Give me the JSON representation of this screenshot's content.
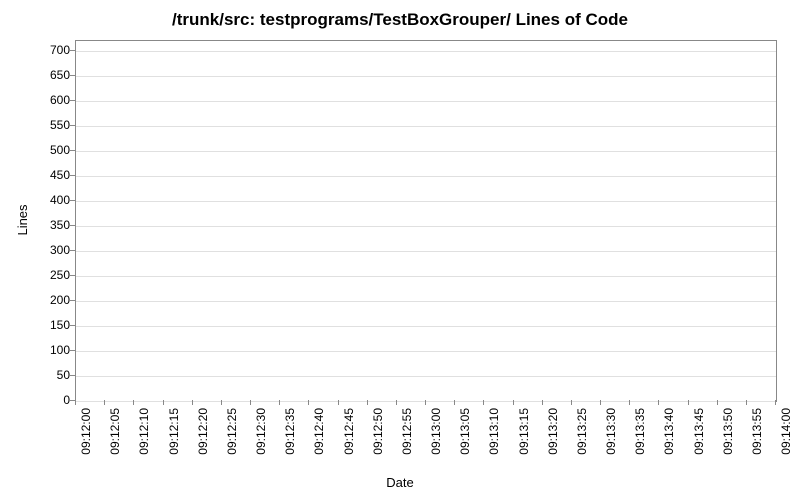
{
  "chart_data": {
    "type": "line",
    "title": "/trunk/src: testprograms/TestBoxGrouper/ Lines of Code",
    "xlabel": "Date",
    "ylabel": "Lines",
    "ylim": [
      0,
      720
    ],
    "y_ticks": [
      0,
      50,
      100,
      150,
      200,
      250,
      300,
      350,
      400,
      450,
      500,
      550,
      600,
      650,
      700
    ],
    "x_ticks": [
      "09:12:00",
      "09:12:05",
      "09:12:10",
      "09:12:15",
      "09:12:20",
      "09:12:25",
      "09:12:30",
      "09:12:35",
      "09:12:40",
      "09:12:45",
      "09:12:50",
      "09:12:55",
      "09:13:00",
      "09:13:05",
      "09:13:10",
      "09:13:15",
      "09:13:20",
      "09:13:25",
      "09:13:30",
      "09:13:35",
      "09:13:40",
      "09:13:45",
      "09:13:50",
      "09:13:55",
      "09:14:00"
    ],
    "series": []
  }
}
